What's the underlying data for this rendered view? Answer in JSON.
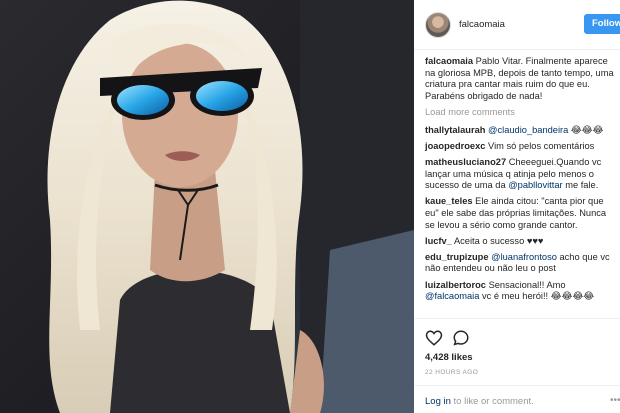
{
  "post": {
    "username": "falcaomaia",
    "follow_label": "Follow",
    "likes": "4,428 likes",
    "time": "22 HOURS AGO",
    "login_link": "Log in",
    "login_rest": " to like or comment."
  },
  "caption": {
    "user": "falcaomaia",
    "text": "Pablo Vitar. Finalmente aparece na gloriosa MPB, depois de tanto tempo, uma criatura pra cantar mais ruim do que eu. Parabéns obrigado de nada!"
  },
  "load_more": "Load more comments",
  "comments": [
    {
      "user": "thallytalaurah",
      "pre": "",
      "mention": "@claudio_bandeira",
      "post": " 😂😂😂"
    },
    {
      "user": "joaopedroexc",
      "pre": "Vim só pelos comentários",
      "mention": "",
      "post": ""
    },
    {
      "user": "matheusluciano27",
      "pre": "Cheeeguei.Quando vc lançar uma música q atinja pelo menos o sucesso de uma da ",
      "mention": "@pabllovittar",
      "post": " me fale."
    },
    {
      "user": "kaue_teles",
      "pre": "Ele ainda citou: \"canta pior que eu\" ele sabe das próprias limitações. Nunca se levou a sério como grande cantor.",
      "mention": "",
      "post": ""
    },
    {
      "user": "lucfv_",
      "pre": "Aceita o sucesso ♥♥♥",
      "mention": "",
      "post": ""
    },
    {
      "user": "edu_trupizupe",
      "pre": "",
      "mention": "@luanafrontoso",
      "post": " acho que vc não entendeu ou não leu o post"
    },
    {
      "user": "luizalbertoroc",
      "pre": "Sensacional!! Amo ",
      "mention": "@falcaomaia",
      "post": " vc é meu herói!! 😂😂😂😂"
    }
  ],
  "icons": {
    "heart": "heart-icon",
    "comment": "comment-icon",
    "more": "more-options-icon",
    "avatar": "avatar"
  },
  "colors": {
    "follow_button": "#3897f0",
    "link": "#003569",
    "muted": "#999999",
    "text": "#262626"
  }
}
